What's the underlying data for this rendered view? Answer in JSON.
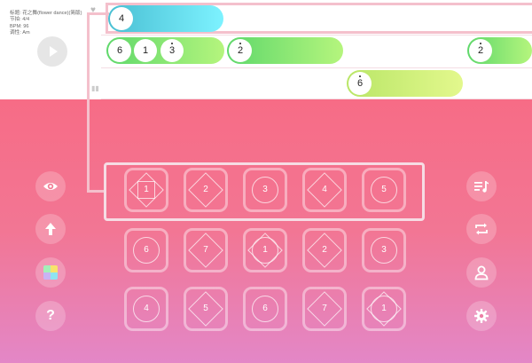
{
  "song_info": {
    "title": "标题: 花之舞(flower dance)(简版)",
    "meter": "节拍: 4/4",
    "bpm": "BPM: 96",
    "key": "调性: Am"
  },
  "timeline": {
    "row1": {
      "active_note": "4"
    },
    "row2": {
      "notes": [
        "6",
        "1",
        "3"
      ],
      "note_b": "2",
      "note_c": "2"
    },
    "row3": {
      "note": "6"
    }
  },
  "pad": {
    "rows": [
      [
        "1",
        "2",
        "3",
        "4",
        "5"
      ],
      [
        "6",
        "7",
        "1",
        "2",
        "3"
      ],
      [
        "4",
        "5",
        "6",
        "7",
        "1"
      ]
    ]
  },
  "icons": {
    "left": [
      "eye-icon",
      "arrow-up-icon",
      "color-cube-icon",
      "help-icon"
    ],
    "right": [
      "music-list-icon",
      "repeat-icon",
      "user-icon",
      "gear-icon"
    ],
    "help_glyph": "?"
  },
  "colors": {
    "pad_top": "#f76c86",
    "pad_bottom": "#e387c7",
    "active_bar": "#7df2ff",
    "note_bar": "#5fd86b",
    "highlight_border": "#f4c0cc"
  }
}
